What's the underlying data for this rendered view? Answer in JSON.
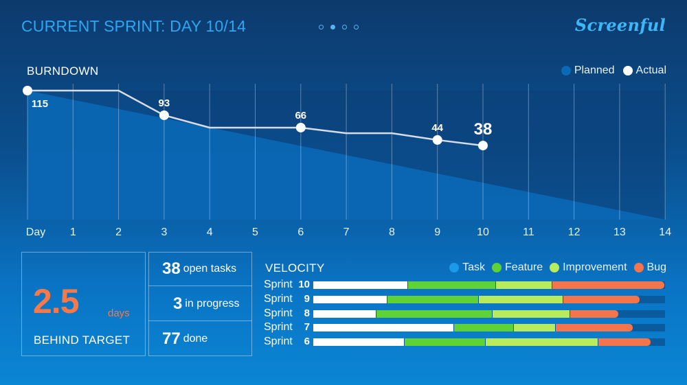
{
  "header": {
    "title": "CURRENT SPRINT: DAY 10/14",
    "pagination": {
      "count": 4,
      "active_index": 1
    },
    "logo": "Screenful"
  },
  "colors": {
    "accent": "#2ea6f0",
    "planned": "#0a6ab8",
    "actual": "#ffffff",
    "task": "#1a9ae8",
    "feature": "#5fd236",
    "improvement": "#b8ec5c",
    "bug": "#f4744c",
    "highlight": "#f7794a"
  },
  "burndown": {
    "title": "BURNDOWN",
    "legend": [
      {
        "label": "Planned",
        "color": "#0a6ab8"
      },
      {
        "label": "Actual",
        "color": "#ffffff"
      }
    ],
    "axis_first_label": "Day"
  },
  "stats": {
    "behind_value": "2.5",
    "behind_unit": "days",
    "behind_label": "BEHIND TARGET",
    "open_num": "38",
    "open_text": "open tasks",
    "progress_num": "3",
    "progress_text": "in progress",
    "done_num": "77",
    "done_text": "done"
  },
  "velocity": {
    "title": "VELOCITY",
    "legend": [
      {
        "label": "Task",
        "color": "#1a9ae8"
      },
      {
        "label": "Feature",
        "color": "#5fd236"
      },
      {
        "label": "Improvement",
        "color": "#b8ec5c"
      },
      {
        "label": "Bug",
        "color": "#f4744c"
      }
    ],
    "sprint_word": "Sprint"
  },
  "chart_data": [
    {
      "type": "area",
      "title": "BURNDOWN",
      "xlabel": "Day",
      "ylabel": "",
      "x_ticks": [
        1,
        2,
        3,
        4,
        5,
        6,
        7,
        8,
        9,
        10,
        11,
        12,
        13,
        14
      ],
      "xlim": [
        0,
        14
      ],
      "ylim": [
        0,
        115
      ],
      "grid": true,
      "legend_position": "top-right",
      "series": [
        {
          "name": "Planned",
          "x": [
            0,
            14
          ],
          "y": [
            115,
            0
          ]
        },
        {
          "name": "Actual",
          "x": [
            0,
            1,
            2,
            3,
            4,
            5,
            6,
            7,
            8,
            9,
            10
          ],
          "y": [
            115,
            115,
            115,
            93,
            82,
            82,
            82,
            77,
            77,
            71,
            66
          ],
          "labels": [
            "115",
            "",
            "",
            "93",
            "",
            "",
            "66",
            "",
            "",
            "44",
            "38"
          ]
        }
      ]
    },
    {
      "type": "bar",
      "orientation": "horizontal",
      "stacked": true,
      "title": "VELOCITY",
      "categories": [
        "10",
        "9",
        "8",
        "7",
        "6"
      ],
      "series": [
        {
          "name": "Task",
          "values": [
            27,
            21,
            18,
            40,
            26
          ]
        },
        {
          "name": "Feature",
          "values": [
            25,
            26,
            33,
            17,
            23
          ]
        },
        {
          "name": "Improvement",
          "values": [
            16,
            24,
            22,
            12,
            32
          ]
        },
        {
          "name": "Bug",
          "values": [
            32,
            22,
            14,
            22,
            15
          ]
        }
      ],
      "xlim": [
        0,
        100
      ],
      "legend_position": "top-right"
    }
  ]
}
